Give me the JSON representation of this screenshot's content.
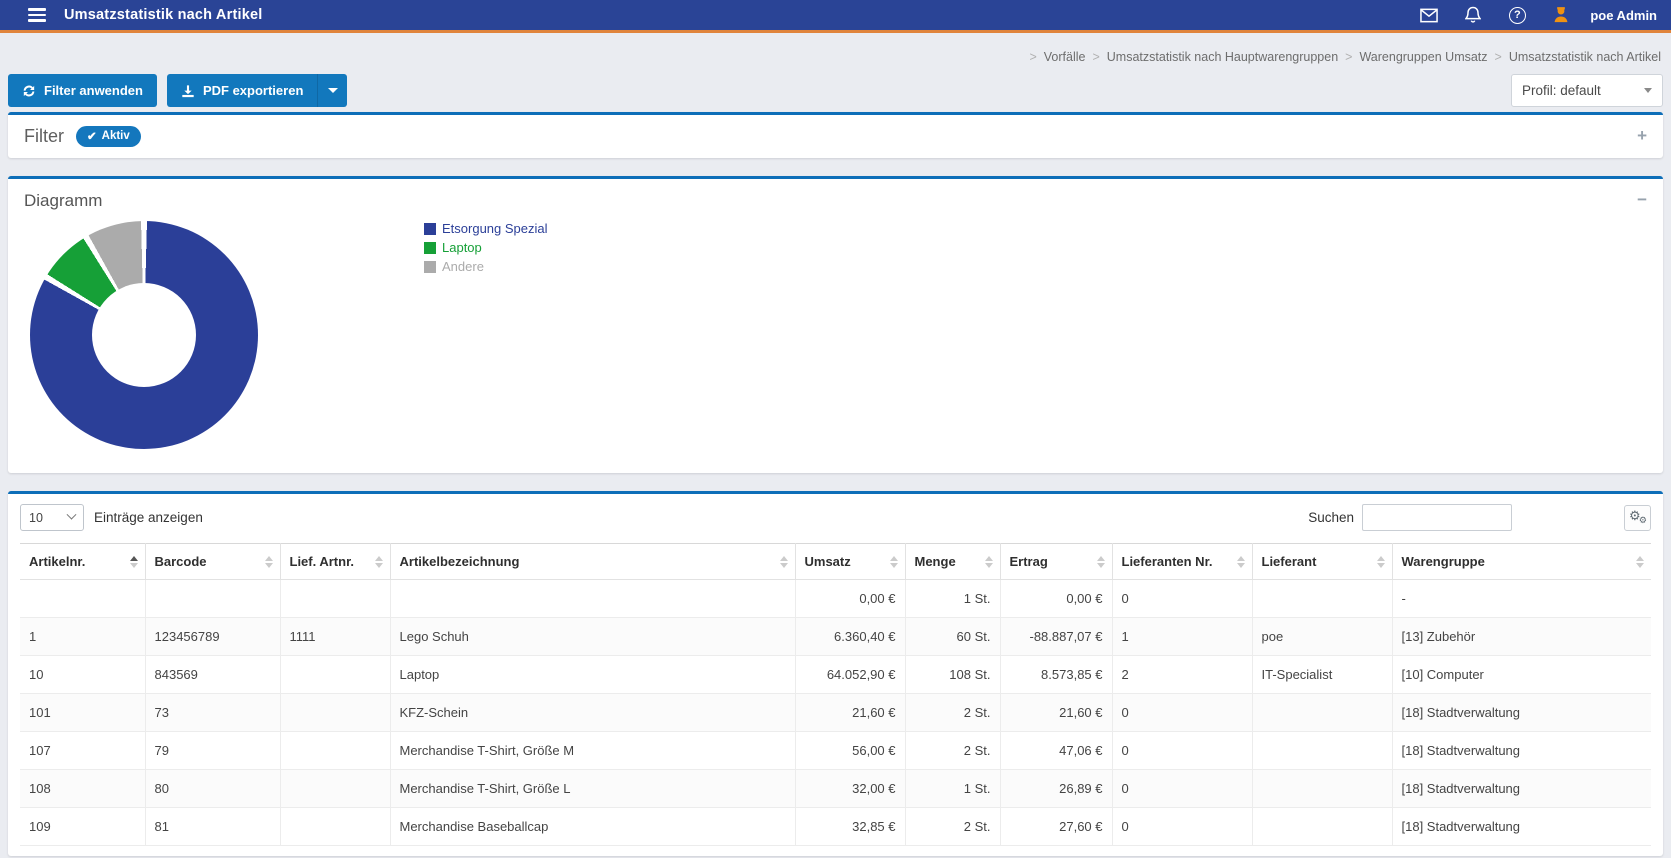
{
  "navbar": {
    "title": "Umsatzstatistik nach Artikel",
    "user": "poe Admin",
    "icons": [
      "mail-icon",
      "bell-icon",
      "help-icon",
      "user-icon"
    ],
    "bg_color": "#2a4496",
    "accent_line_color": "#e0843c",
    "user_icon_color": "#ef9212"
  },
  "breadcrumb": {
    "separator": ">",
    "items": [
      "Vorfälle",
      "Umsatzstatistik nach Hauptwarengruppen",
      "Warengruppen Umsatz",
      "Umsatzstatistik nach Artikel"
    ]
  },
  "toolbar": {
    "apply_filter_label": "Filter anwenden",
    "pdf_export_label": "PDF exportieren",
    "profile_select_value": "Profil: default",
    "button_color": "#1278bd"
  },
  "filter_panel": {
    "title": "Filter",
    "badge_check": "✔",
    "badge_label": "Aktiv",
    "collapse_icon": "+"
  },
  "chart_panel": {
    "title": "Diagramm",
    "collapse_icon": "−"
  },
  "chart_data": {
    "type": "pie",
    "subtype": "donut",
    "labels": [
      "Etsorgung Spezial",
      "Laptop",
      "Andere"
    ],
    "values_percent": [
      83.5,
      8.0,
      8.5
    ],
    "colors": [
      "#2b3f98",
      "#16a037",
      "#ababab"
    ],
    "legend_position": "right",
    "start_angle_degrees": 0,
    "slice_gap_degrees": 3,
    "donut_hole_ratio": 0.45
  },
  "table_panel": {
    "length_select": {
      "value": "10",
      "options": [
        "10"
      ]
    },
    "length_label": "Einträge anzeigen",
    "search_label": "Suchen",
    "search_value": "",
    "columns": [
      {
        "label": "Artikelnr.",
        "body_align": "left",
        "sort": "asc"
      },
      {
        "label": "Barcode",
        "body_align": "left",
        "sort": "none"
      },
      {
        "label": "Lief. Artnr.",
        "body_align": "left",
        "sort": "none"
      },
      {
        "label": "Artikelbezeichnung",
        "body_align": "left",
        "sort": "none"
      },
      {
        "label": "Umsatz",
        "body_align": "right",
        "sort": "none"
      },
      {
        "label": "Menge",
        "body_align": "right",
        "sort": "none"
      },
      {
        "label": "Ertrag",
        "body_align": "right",
        "sort": "none"
      },
      {
        "label": "Lieferanten Nr.",
        "body_align": "left",
        "sort": "none"
      },
      {
        "label": "Lieferant",
        "body_align": "left",
        "sort": "none"
      },
      {
        "label": "Warengruppe",
        "body_align": "left",
        "sort": "none"
      }
    ],
    "rows": [
      [
        "",
        "",
        "",
        "",
        "0,00 €",
        "1 St.",
        "0,00 €",
        "0",
        "",
        "-"
      ],
      [
        "1",
        "123456789",
        "1111",
        "Lego Schuh",
        "6.360,40 €",
        "60 St.",
        "-88.887,07 €",
        "1",
        "poe",
        "[13] Zubehör"
      ],
      [
        "10",
        "843569",
        "",
        "Laptop",
        "64.052,90 €",
        "108 St.",
        "8.573,85 €",
        "2",
        "IT-Specialist",
        "[10] Computer"
      ],
      [
        "101",
        "73",
        "",
        "KFZ-Schein",
        "21,60 €",
        "2 St.",
        "21,60 €",
        "0",
        "",
        "[18] Stadtverwaltung"
      ],
      [
        "107",
        "79",
        "",
        "Merchandise T-Shirt, Größe M",
        "56,00 €",
        "2 St.",
        "47,06 €",
        "0",
        "",
        "[18] Stadtverwaltung"
      ],
      [
        "108",
        "80",
        "",
        "Merchandise T-Shirt, Größe L",
        "32,00 €",
        "1 St.",
        "26,89 €",
        "0",
        "",
        "[18] Stadtverwaltung"
      ],
      [
        "109",
        "81",
        "",
        "Merchandise Baseballcap",
        "32,85 €",
        "2 St.",
        "27,60 €",
        "0",
        "",
        "[18] Stadtverwaltung"
      ]
    ]
  }
}
